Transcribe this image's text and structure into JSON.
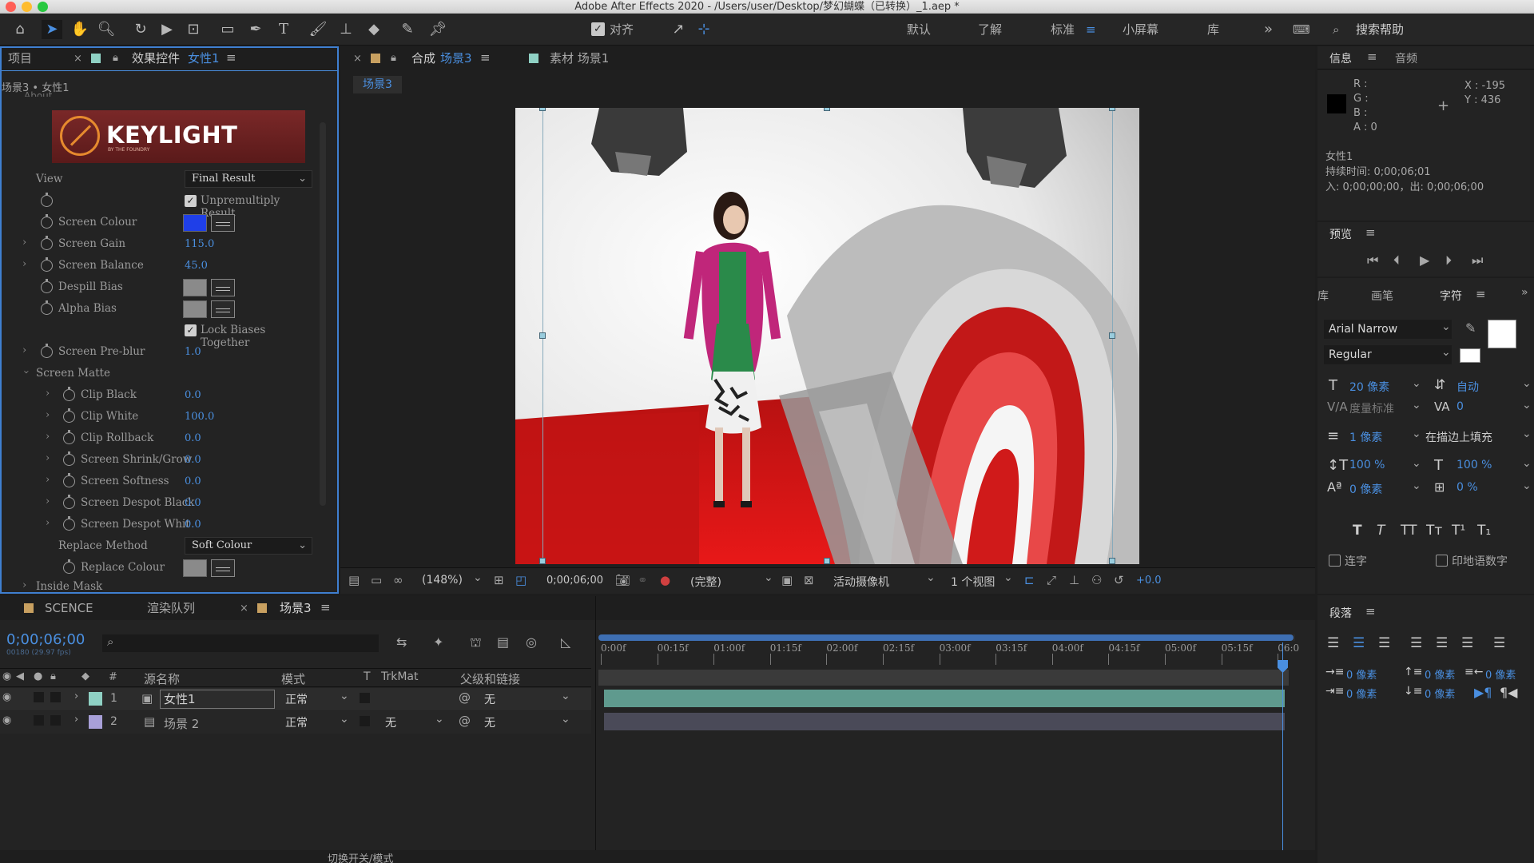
{
  "window": {
    "title": "Adobe After Effects 2020 - /Users/user/Desktop/梦幻蝴蝶（已转换）_1.aep *"
  },
  "toolbar": {
    "align_label": "对齐",
    "workspaces": [
      "默认",
      "了解",
      "标准",
      "小屏幕",
      "库"
    ],
    "active_workspace": "标准",
    "search_help": "搜索帮助"
  },
  "left_panel": {
    "tab_project": "项目",
    "tab_effects": "效果控件",
    "tab_effects_layer": "女性1",
    "breadcrumb": "场景3 • 女性1",
    "about": "About",
    "logo_text": "KEYLIGHT",
    "logo_sub": "BY THE FOUNDRY",
    "view_label": "View",
    "view_value": "Final Result",
    "unpremultiply": "Unpremultiply Result",
    "screen_colour": "Screen Colour",
    "screen_colour_value": "#1f3fe8",
    "screen_gain": "Screen Gain",
    "screen_gain_value": "115.0",
    "screen_balance": "Screen Balance",
    "screen_balance_value": "45.0",
    "despill_bias": "Despill Bias",
    "alpha_bias": "Alpha Bias",
    "lock_biases": "Lock Biases Together",
    "screen_preblur": "Screen Pre-blur",
    "screen_preblur_value": "1.0",
    "screen_matte": "Screen Matte",
    "clip_black": "Clip Black",
    "clip_black_value": "0.0",
    "clip_white": "Clip White",
    "clip_white_value": "100.0",
    "clip_rollback": "Clip Rollback",
    "clip_rollback_value": "0.0",
    "shrink_grow": "Screen Shrink/Grow",
    "shrink_grow_value": "0.0",
    "softness": "Screen Softness",
    "softness_value": "0.0",
    "despot_black": "Screen Despot Black",
    "despot_black_value": "0.0",
    "despot_white": "Screen Despot Whit",
    "despot_white_value": "0.0",
    "replace_method": "Replace Method",
    "replace_method_value": "Soft Colour",
    "replace_colour": "Replace Colour",
    "inside_mask": "Inside Mask"
  },
  "viewer": {
    "tab_comp": "合成",
    "tab_comp_name": "场景3",
    "tab_footage": "素材 场景1",
    "comp_chip": "场景3",
    "zoom": "(148%)",
    "timecode": "0;00;06;00",
    "resolution": "(完整)",
    "camera": "活动摄像机",
    "views": "1 个视图",
    "exposure": "+0.0"
  },
  "timeline": {
    "tabs": [
      "SCENCE",
      "渲染队列",
      "场景3"
    ],
    "timecode": "0;00;06;00",
    "fps": "00180 (29.97 fps)",
    "col_source": "源名称",
    "col_mode": "模式",
    "col_t": "T",
    "col_trkmat": "TrkMat",
    "col_parent": "父级和链接",
    "ruler": [
      "0:00f",
      "00:15f",
      "01:00f",
      "01:15f",
      "02:00f",
      "02:15f",
      "03:00f",
      "03:15f",
      "04:00f",
      "04:15f",
      "05:00f",
      "05:15f",
      "06:0"
    ],
    "layers": [
      {
        "num": "1",
        "name": "女性1",
        "mode": "正常",
        "trkmat": "",
        "parent": "无",
        "label_color": "#8fd1c4"
      },
      {
        "num": "2",
        "name": "场景 2",
        "mode": "正常",
        "trkmat": "无",
        "parent": "无",
        "label_color": "#a8a0d8"
      }
    ],
    "bottom": "切换开关/模式"
  },
  "info": {
    "tab_info": "信息",
    "tab_audio": "音频",
    "r": "R :",
    "g": "G :",
    "b": "B :",
    "a": "A : 0",
    "x": "X : -195",
    "y": "Y : 436",
    "layer": "女性1",
    "duration": "持续时间: 0;00;06;01",
    "inout": "入: 0;00;00;00，出: 0;00;06;00"
  },
  "preview": {
    "title": "预览"
  },
  "character": {
    "tab_lib": "库",
    "tab_brush": "画笔",
    "tab_char": "字符",
    "font": "Arial Narrow",
    "style": "Regular",
    "size": "20 像素",
    "leading": "自动",
    "kerning": "度量标准",
    "tracking": "0",
    "stroke": "1 像素",
    "stroke_mode": "在描边上填充",
    "vscale": "100 %",
    "hscale": "100 %",
    "baseline": "0 像素",
    "tsume": "0 %",
    "ligatures": "连字",
    "hindi": "印地语数字"
  },
  "paragraph": {
    "title": "段落",
    "indent": "0 像素"
  }
}
